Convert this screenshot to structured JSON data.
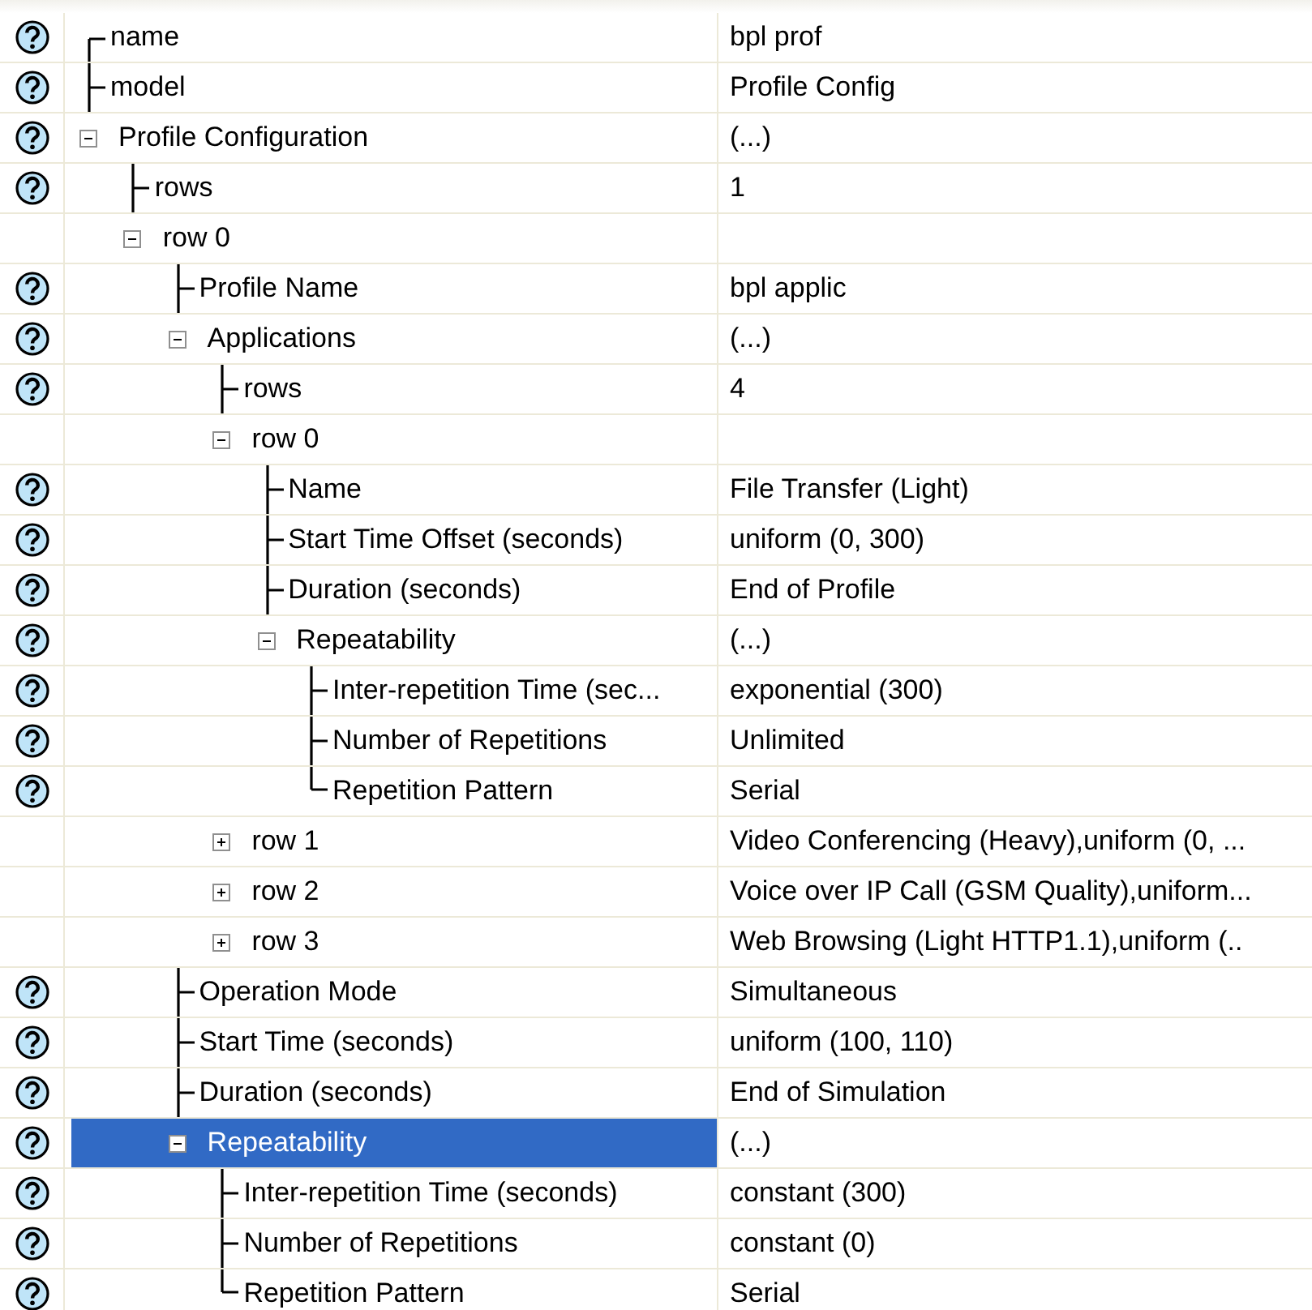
{
  "tree": [
    {
      "kind": "property",
      "label": "name",
      "value": "bpl prof",
      "help": true,
      "selected": false
    },
    {
      "kind": "property",
      "label": "model",
      "value": "Profile Config",
      "help": true,
      "selected": false
    },
    {
      "kind": "group",
      "label": "Profile Configuration",
      "value": "(...)",
      "help": true,
      "expanded": true,
      "selected": false,
      "children": [
        {
          "kind": "property",
          "label": "rows",
          "value": "1",
          "help": true,
          "selected": false
        },
        {
          "kind": "group",
          "label": "row 0",
          "help": false,
          "expanded": true,
          "selected": false,
          "children": [
            {
              "kind": "property",
              "label": "Profile Name",
              "value": "bpl applic",
              "help": true,
              "selected": false
            },
            {
              "kind": "group",
              "label": "Applications",
              "value": "(...)",
              "help": true,
              "expanded": true,
              "selected": false,
              "children": [
                {
                  "kind": "property",
                  "label": "rows",
                  "value": "4",
                  "help": true,
                  "selected": false
                },
                {
                  "kind": "group",
                  "label": "row 0",
                  "help": false,
                  "expanded": true,
                  "selected": false,
                  "children": [
                    {
                      "kind": "property",
                      "label": "Name",
                      "value": "File Transfer (Light)",
                      "help": true,
                      "selected": false
                    },
                    {
                      "kind": "property",
                      "label": "Start Time Offset (seconds)",
                      "value": "uniform (0, 300)",
                      "help": true,
                      "selected": false
                    },
                    {
                      "kind": "property",
                      "label": "Duration (seconds)",
                      "value": "End of Profile",
                      "help": true,
                      "selected": false
                    },
                    {
                      "kind": "group",
                      "label": "Repeatability",
                      "value": "(...)",
                      "help": true,
                      "expanded": true,
                      "selected": false,
                      "children": [
                        {
                          "kind": "property",
                          "label": "Inter-repetition Time (sec...",
                          "value": "exponential (300)",
                          "help": true,
                          "selected": false
                        },
                        {
                          "kind": "property",
                          "label": "Number of Repetitions",
                          "value": "Unlimited",
                          "help": true,
                          "selected": false
                        },
                        {
                          "kind": "property",
                          "label": "Repetition Pattern",
                          "value": "Serial",
                          "help": true,
                          "selected": false
                        }
                      ]
                    }
                  ]
                },
                {
                  "kind": "group",
                  "label": "row 1",
                  "value": "Video Conferencing (Heavy),uniform (0, ...",
                  "help": false,
                  "expanded": false,
                  "selected": false
                },
                {
                  "kind": "group",
                  "label": "row 2",
                  "value": "Voice over IP Call (GSM Quality),uniform...",
                  "help": false,
                  "expanded": false,
                  "selected": false
                },
                {
                  "kind": "group",
                  "label": "row 3",
                  "value": "Web Browsing (Light HTTP1.1),uniform (..",
                  "help": false,
                  "expanded": false,
                  "selected": false
                }
              ]
            },
            {
              "kind": "property",
              "label": "Operation Mode",
              "value": "Simultaneous",
              "help": true,
              "selected": false
            },
            {
              "kind": "property",
              "label": "Start Time (seconds)",
              "value": "uniform (100, 110)",
              "help": true,
              "selected": false
            },
            {
              "kind": "property",
              "label": "Duration (seconds)",
              "value": "End of Simulation",
              "help": true,
              "selected": false
            },
            {
              "kind": "group",
              "label": "Repeatability",
              "value": "(...)",
              "help": true,
              "expanded": true,
              "selected": true,
              "children": [
                {
                  "kind": "property",
                  "label": "Inter-repetition Time (seconds)",
                  "value": "constant (300)",
                  "help": true,
                  "selected": false
                },
                {
                  "kind": "property",
                  "label": "Number of Repetitions",
                  "value": "constant (0)",
                  "help": true,
                  "selected": false
                },
                {
                  "kind": "property",
                  "label": "Repetition Pattern",
                  "value": "Serial",
                  "help": true,
                  "selected": false
                }
              ]
            }
          ]
        }
      ]
    }
  ]
}
